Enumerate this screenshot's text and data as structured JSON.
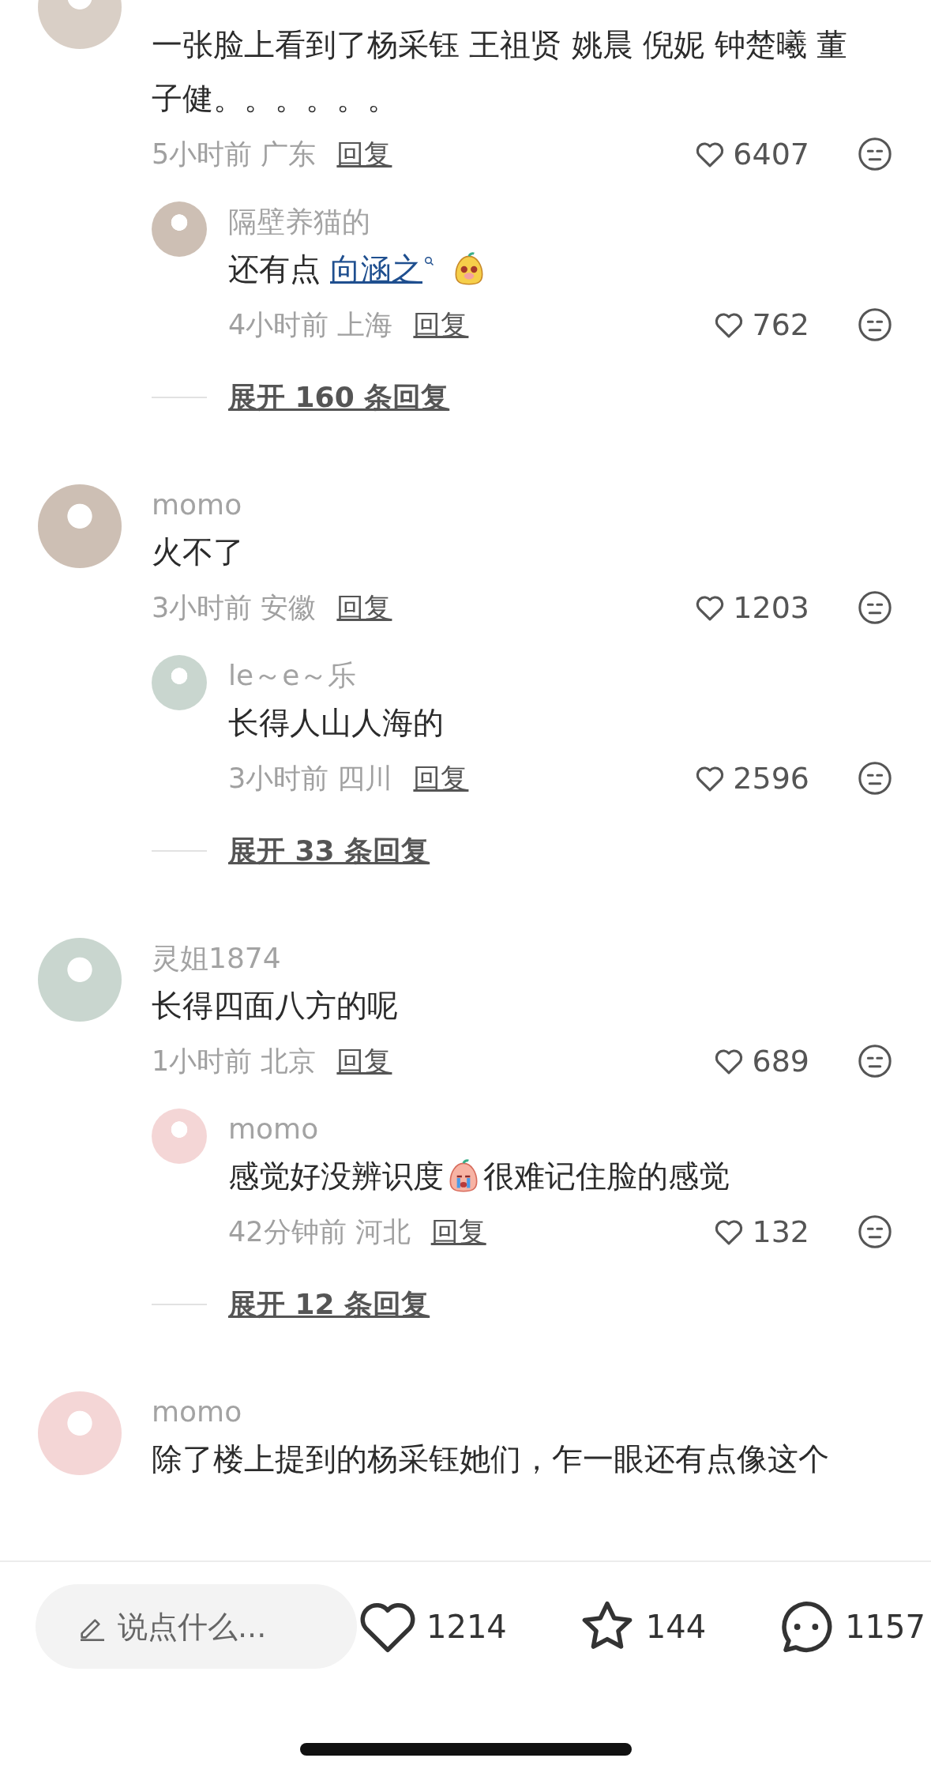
{
  "comments": [
    {
      "text": "一张脸上看到了杨采钰 王祖贤 姚晨 倪妮 钟楚曦 董子健。。。。。。",
      "time": "5小时前",
      "location": "广东",
      "reply": "回复",
      "likes": "6407",
      "replies": [
        {
          "author": "隔壁养猫的",
          "content": [
            {
              "kind": "text",
              "text": "还有点"
            },
            {
              "kind": "mention",
              "text": "向涵之"
            },
            {
              "kind": "sticker"
            }
          ],
          "time": "4小时前",
          "location": "上海",
          "reply": "回复",
          "likes": "762"
        }
      ],
      "expand": "展开 160 条回复"
    },
    {
      "author": "momo",
      "text": "火不了",
      "time": "3小时前",
      "location": "安徽",
      "reply": "回复",
      "likes": "1203",
      "replies": [
        {
          "author": "le～e～乐",
          "content": [
            {
              "kind": "text",
              "text": "长得人山人海的"
            }
          ],
          "time": "3小时前",
          "location": "四川",
          "reply": "回复",
          "likes": "2596"
        }
      ],
      "expand": "展开 33 条回复"
    },
    {
      "author": "灵姐1874",
      "text": "长得四面八方的呢",
      "time": "1小时前",
      "location": "北京",
      "reply": "回复",
      "likes": "689",
      "replies": [
        {
          "author": "momo",
          "content": [
            {
              "kind": "text",
              "text": "感觉好没辨识度"
            },
            {
              "kind": "crying-sticker"
            },
            {
              "kind": "text",
              "text": "很难记住脸的感觉"
            }
          ],
          "time": "42分钟前",
          "location": "河北",
          "reply": "回复",
          "likes": "132"
        }
      ],
      "expand": "展开 12 条回复"
    },
    {
      "author": "momo",
      "text": "除了楼上提到的杨采钰她们，乍一眼还有点像这个"
    }
  ],
  "composer": {
    "placeholder": "说点什么..."
  },
  "actions": [
    {
      "kind": "like",
      "count": "1214"
    },
    {
      "kind": "collect",
      "count": "144"
    },
    {
      "kind": "comment",
      "count": "1157"
    }
  ]
}
